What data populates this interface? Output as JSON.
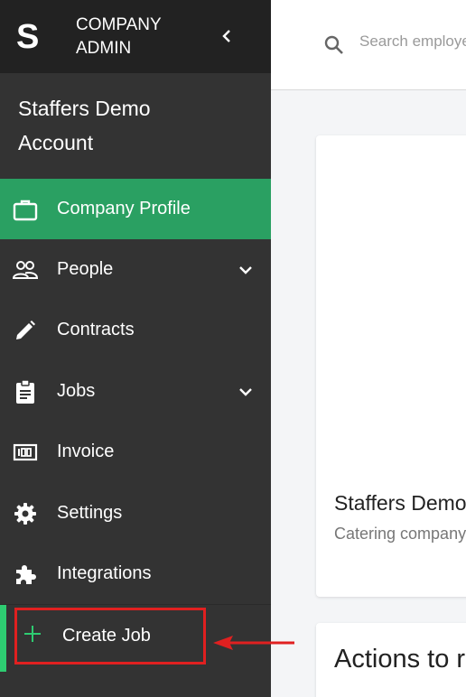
{
  "brand": {
    "logo": "S",
    "title_line1": "COMPANY",
    "title_line2": "ADMIN"
  },
  "account": {
    "name_line1": "Staffers Demo",
    "name_line2": "Account"
  },
  "nav": [
    {
      "label": "Company Profile",
      "icon": "briefcase-icon",
      "active": true
    },
    {
      "label": "People",
      "icon": "people-icon",
      "expandable": true
    },
    {
      "label": "Contracts",
      "icon": "pencil-icon"
    },
    {
      "label": "Jobs",
      "icon": "clipboard-icon",
      "expandable": true
    },
    {
      "label": "Invoice",
      "icon": "invoice-icon"
    },
    {
      "label": "Settings",
      "icon": "gear-icon"
    },
    {
      "label": "Integrations",
      "icon": "puzzle-icon"
    }
  ],
  "create_job": {
    "label": "Create Job",
    "icon": "plus-icon"
  },
  "search": {
    "placeholder": "Search employees"
  },
  "company_card": {
    "title": "Staffers Demo Account",
    "subtitle": "Catering company"
  },
  "actions_card": {
    "title": "Actions to review"
  },
  "colors": {
    "sidebar": "#333333",
    "brand_bg": "#222222",
    "active": "#2aa062",
    "accent_green": "#2ecc71",
    "highlight_red": "#e02020"
  }
}
